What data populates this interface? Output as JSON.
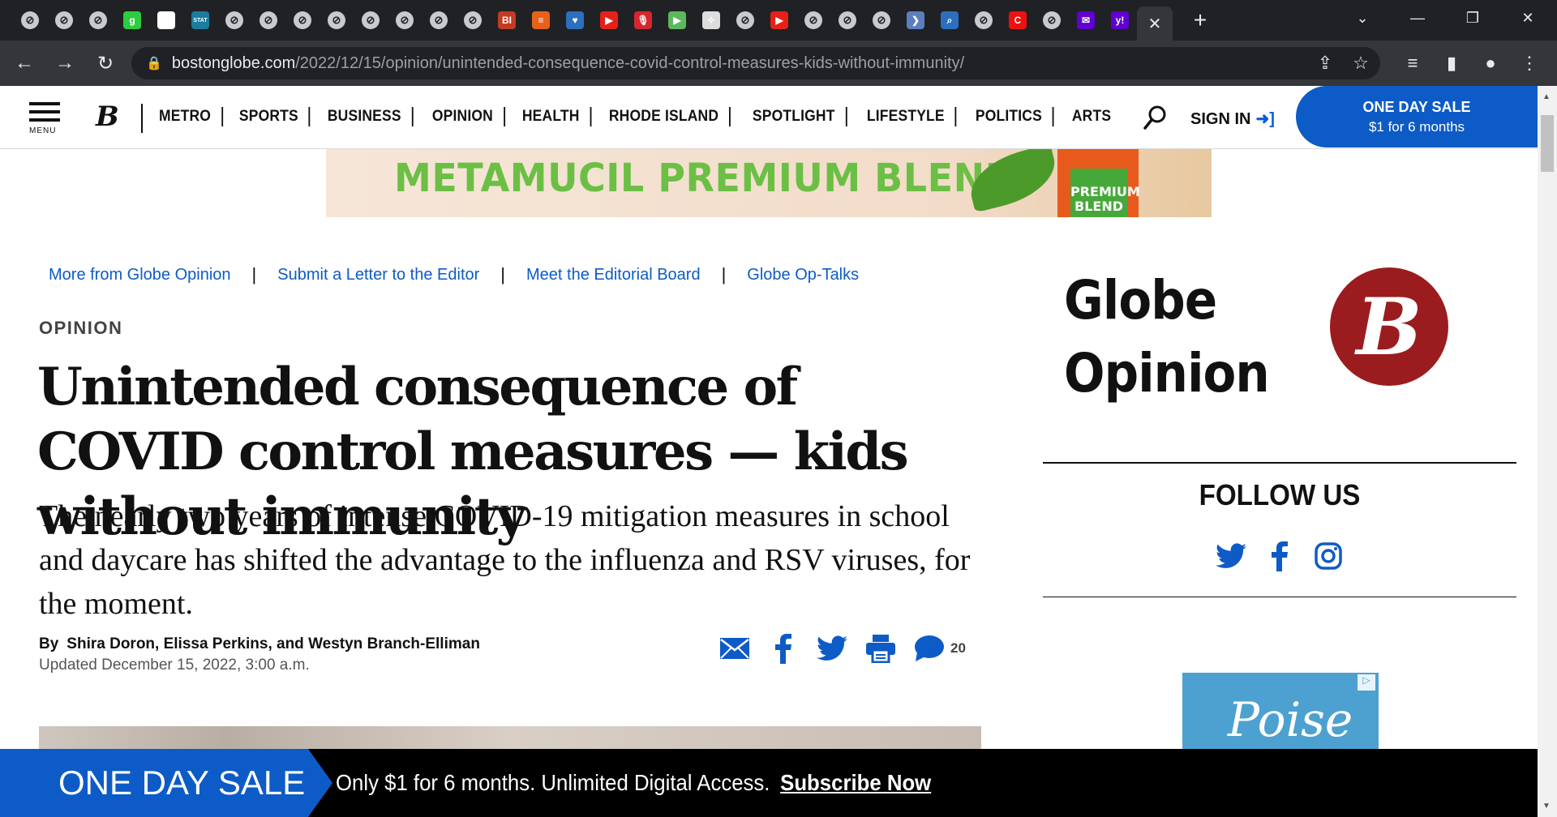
{
  "browser": {
    "tab_favicons": [
      "globe",
      "globe",
      "globe",
      "g",
      "white-square",
      "stat",
      "globe",
      "globe",
      "globe",
      "globe",
      "globe",
      "globe",
      "globe",
      "globe",
      "BI",
      "bars",
      "shield",
      "youtube",
      "podcast",
      "play",
      "puzzle",
      "globe",
      "youtube",
      "globe",
      "globe",
      "globe",
      "chevron",
      "search",
      "globe",
      "red-c",
      "globe",
      "mail",
      "y!"
    ],
    "active_tab_close": "✕",
    "new_tab": "+",
    "url_host": "bostonglobe.com",
    "url_path": "/2022/12/15/opinion/unintended-consequence-covid-control-measures-kids-without-immunity/"
  },
  "header": {
    "menu_label": "MENU",
    "logo": "B",
    "nav": [
      "METRO",
      "SPORTS",
      "BUSINESS",
      "OPINION",
      "HEALTH",
      "RHODE ISLAND",
      "SPOTLIGHT",
      "LIFESTYLE",
      "POLITICS",
      "ARTS"
    ],
    "sign_in": "SIGN IN",
    "sale_line1": "ONE DAY SALE",
    "sale_line2": "$1 for 6 months"
  },
  "ad_banner": {
    "text": "METAMUCIL PREMIUM BLEND",
    "pack_text": "PREMIUM BLEND"
  },
  "article": {
    "links": [
      "More from Globe Opinion",
      "Submit a Letter to the Editor",
      "Meet the Editorial Board",
      "Globe Op-Talks"
    ],
    "kicker": "OPINION",
    "headline": "Unintended consequence of COVID control measures — kids without immunity",
    "dek": "The nearly two years of intense COVID-19 mitigation measures in school and daycare has shifted the advantage to the influenza and RSV viruses, for the moment.",
    "by": "By",
    "authors": "Shira Doron, Elissa Perkins, and Westyn Branch-Elliman",
    "updated": "Updated December 15, 2022, 3:00 a.m.",
    "comment_count": "20"
  },
  "sidebar": {
    "title_line1": "Globe",
    "title_line2": "Opinion",
    "logo": "B",
    "follow": "FOLLOW US",
    "ad_word": "Poise"
  },
  "sale_bar": {
    "tag": "ONE DAY SALE",
    "message": "Only $1 for 6 months. Unlimited Digital Access.",
    "cta": "Subscribe Now"
  },
  "colors": {
    "brand_blue": "#0d5bc6",
    "globe_red": "#9b1c1f",
    "chrome_dark": "#202124"
  }
}
